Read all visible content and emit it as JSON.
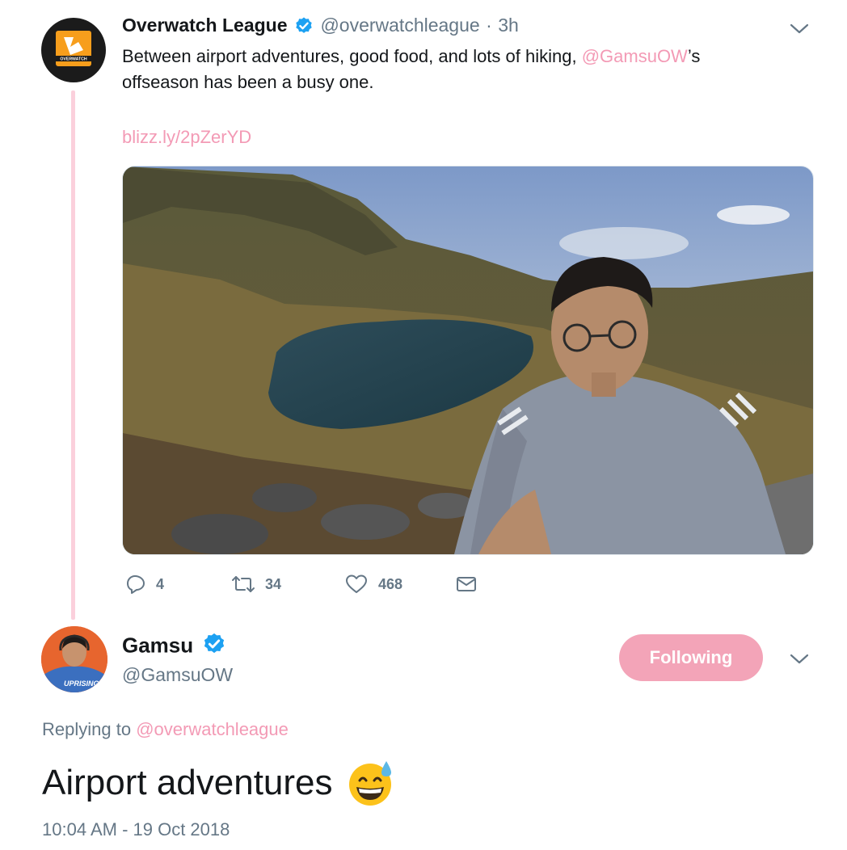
{
  "tweet": {
    "display_name": "Overwatch League",
    "handle": "@overwatchleague",
    "separator": "·",
    "time": "3h",
    "avatar_text_line1": "OVERWATCH",
    "avatar_text_line2": "LEAGUE",
    "text_before": "Between airport adventures, good food, and lots of hiking, ",
    "mention": "@GamsuOW",
    "text_after_mention": "’s offseason has been a busy one.",
    "link": "blizz.ly/2pZerYD",
    "actions": {
      "replies": "4",
      "retweets": "34",
      "likes": "468"
    }
  },
  "reply": {
    "display_name": "Gamsu",
    "handle": "@GamsuOW",
    "follow_button": "Following",
    "replying_prefix": "Replying to",
    "replying_to": "@overwatchleague",
    "text": "Airport adventures",
    "timestamp": "10:04 AM - 19 Oct 2018",
    "avatar_jersey_text": "UPRISING"
  },
  "colors": {
    "accent_pink": "#f39ab5",
    "follow_button_bg": "#f3a4b8",
    "verified_blue": "#1da1f2",
    "muted_text": "#657786",
    "thread_line": "#fbd0dc"
  },
  "icons": [
    "reply-icon",
    "retweet-icon",
    "like-icon",
    "dm-icon",
    "caret-down-icon",
    "verified-badge-icon",
    "sweat-smile-emoji"
  ]
}
